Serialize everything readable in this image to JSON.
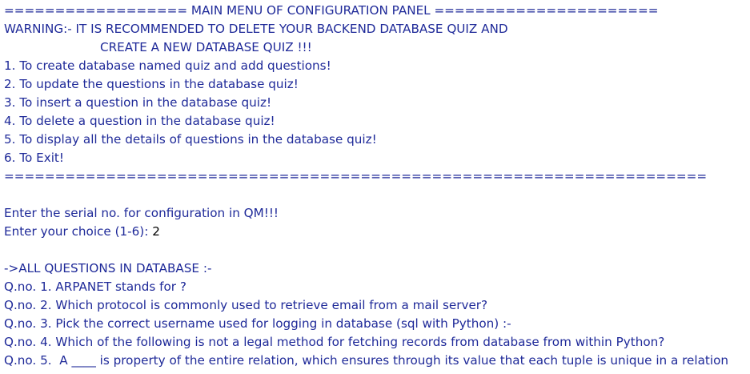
{
  "colors": {
    "output_text": "#1f2a99",
    "input_text": "#000000",
    "background": "#ffffff"
  },
  "menu": {
    "header": "================== MAIN MENU OF CONFIGURATION PANEL ======================",
    "warning_line1": "WARNING:- IT IS RECOMMENDED TO DELETE YOUR BACKEND DATABASE QUIZ AND",
    "warning_line2": "CREATE A NEW DATABASE QUIZ !!!",
    "options": [
      "1. To create database named quiz and add questions!",
      "2. To update the questions in the database quiz!",
      "3. To insert a question in the database quiz!",
      "4. To delete a question in the database quiz!",
      "5. To display all the details of questions in the database quiz!",
      "6. To Exit!"
    ],
    "footer": "====================================================================="
  },
  "prompt": {
    "serial_prompt": "Enter the serial no. for configuration in QM!!!",
    "choice_prompt": "Enter your choice (1-6): ",
    "choice_value": "2"
  },
  "questions": {
    "heading": "->ALL QUESTIONS IN DATABASE :-",
    "items": [
      "Q.no. 1. ARPANET stands for ?",
      "Q.no. 2. Which protocol is commonly used to retrieve email from a mail server?",
      "Q.no. 3. Pick the correct username used for logging in database (sql with Python) :-",
      "Q.no. 4. Which of the following is not a legal method for fetching records from database from within Python?",
      "Q.no. 5.  A ____ is property of the entire relation, which ensures through its value that each tuple is unique in a relation"
    ]
  }
}
